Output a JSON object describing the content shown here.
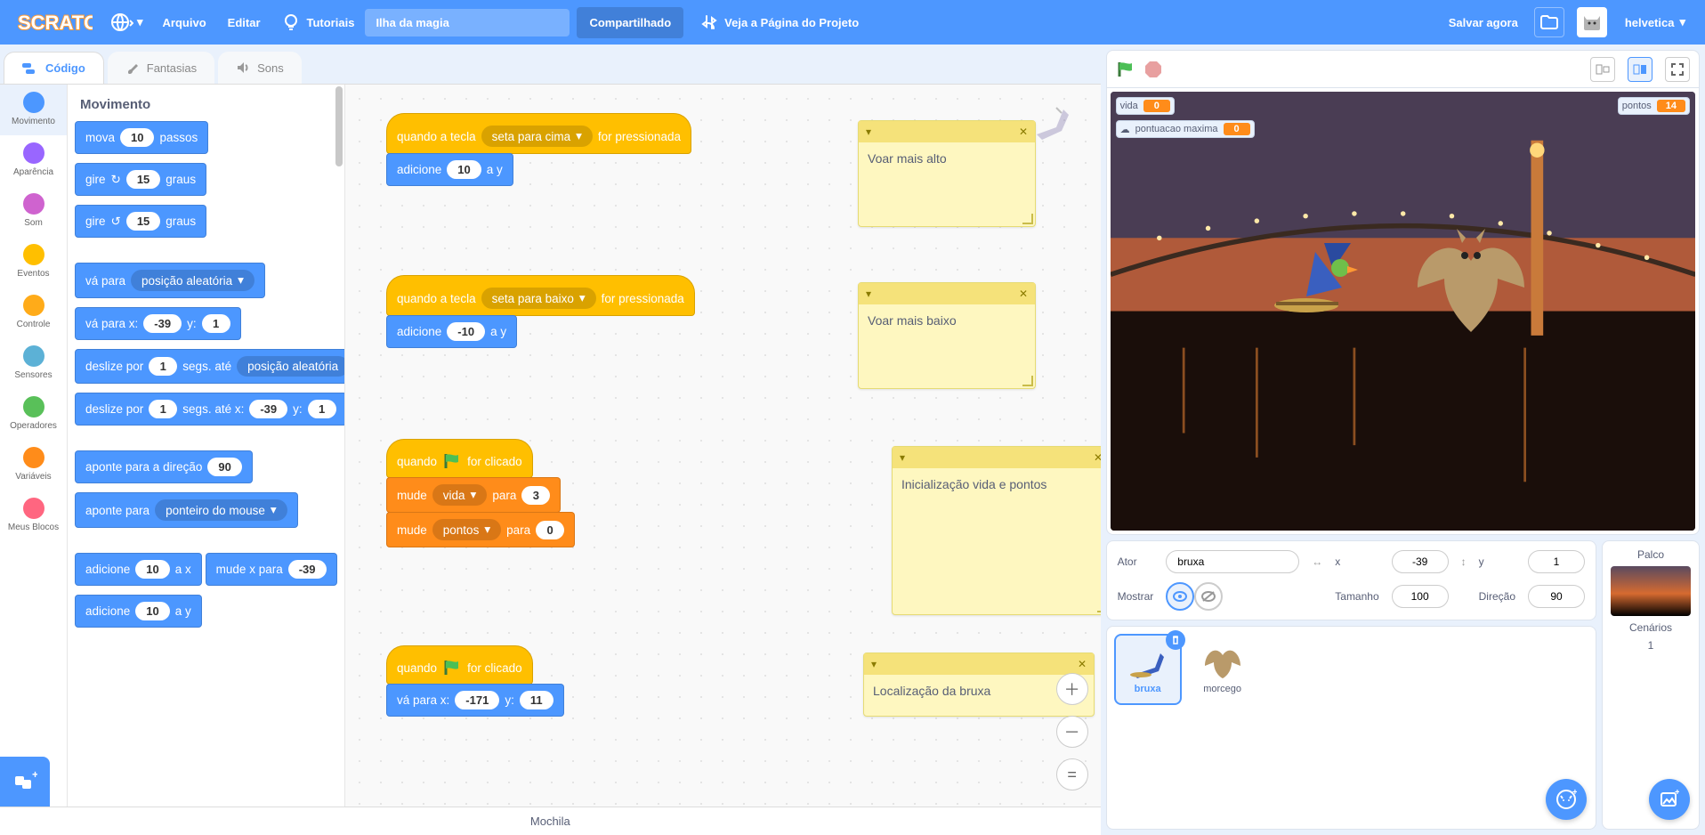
{
  "menubar": {
    "file": "Arquivo",
    "edit": "Editar",
    "tutorials": "Tutoriais",
    "project_title": "Ilha da magia",
    "share": "Compartilhado",
    "see_project_page": "Veja a Página do Projeto",
    "save_now": "Salvar agora",
    "username": "helvetica"
  },
  "tabs": {
    "code": "Código",
    "costumes": "Fantasias",
    "sounds": "Sons"
  },
  "categories": [
    {
      "name": "Movimento",
      "color": "#4c97ff",
      "selected": true
    },
    {
      "name": "Aparência",
      "color": "#9966ff"
    },
    {
      "name": "Som",
      "color": "#cf63cf"
    },
    {
      "name": "Eventos",
      "color": "#ffbf00"
    },
    {
      "name": "Controle",
      "color": "#ffab19"
    },
    {
      "name": "Sensores",
      "color": "#5cb1d6"
    },
    {
      "name": "Operadores",
      "color": "#59c059"
    },
    {
      "name": "Variáveis",
      "color": "#ff8c1a"
    },
    {
      "name": "Meus Blocos",
      "color": "#ff6680"
    }
  ],
  "palette_header": "Movimento",
  "palette_blocks": {
    "move_a": "mova",
    "move_steps": "10",
    "move_b": "passos",
    "turn_a": "gire",
    "turn_deg1": "15",
    "turn_deg2": "15",
    "turn_b": "graus",
    "goto_a": "vá para",
    "goto_opt": "posição aleatória",
    "gotoxy_a": "vá para x:",
    "gotoxy_x": "-39",
    "gotoxy_y_lbl": "y:",
    "gotoxy_y": "1",
    "glide_a": "deslize por",
    "glide_secs1": "1",
    "glide_b": "segs. até",
    "glide_opt": "posição aleatória",
    "glidexy_a": "deslize por",
    "glidexy_secs": "1",
    "glidexy_b": "segs. até x:",
    "glidexy_x": "-39",
    "glidexy_y_lbl": "y:",
    "glidexy_y": "1",
    "point_dir_a": "aponte  para a direção",
    "point_dir_v": "90",
    "point_to_a": "aponte para",
    "point_to_opt": "ponteiro do mouse",
    "changex_a": "adicione",
    "changex_v": "10",
    "changex_b": "a x",
    "setx_a": "mude x para",
    "setx_v": "-39",
    "changey_a": "adicione",
    "changey_v": "10",
    "changey_b": "a y"
  },
  "scripts": {
    "s1": {
      "hat_a": "quando a tecla",
      "hat_opt": "seta para cima",
      "hat_b": "for pressionada",
      "b1_a": "adicione",
      "b1_v": "10",
      "b1_b": "a y",
      "comment": "Voar mais alto"
    },
    "s2": {
      "hat_a": "quando a tecla",
      "hat_opt": "seta para baixo",
      "hat_b": "for pressionada",
      "b1_a": "adicione",
      "b1_v": "-10",
      "b1_b": "a y",
      "comment": "Voar mais baixo"
    },
    "s3": {
      "hat_a": "quando",
      "hat_b": "for clicado",
      "b1_a": "mude",
      "b1_var": "vida",
      "b1_b": "para",
      "b1_v": "3",
      "b2_a": "mude",
      "b2_var": "pontos",
      "b2_b": "para",
      "b2_v": "0",
      "comment": "Inicialização vida e pontos"
    },
    "s4": {
      "hat_a": "quando",
      "hat_b": "for clicado",
      "b1_a": "vá para x:",
      "b1_x": "-171",
      "b1_y_lbl": "y:",
      "b1_y": "11",
      "comment": "Localização da bruxa"
    }
  },
  "backpack": "Mochila",
  "stage": {
    "monitors": {
      "vida_label": "vida",
      "vida_value": "0",
      "pm_label": "pontuacao maxima",
      "pm_value": "0",
      "pontos_label": "pontos",
      "pontos_value": "14"
    }
  },
  "sprite_info": {
    "actor_lbl": "Ator",
    "actor_name": "bruxa",
    "x_lbl": "x",
    "x": "-39",
    "y_lbl": "y",
    "y": "1",
    "show_lbl": "Mostrar",
    "size_lbl": "Tamanho",
    "size": "100",
    "dir_lbl": "Direção",
    "dir": "90"
  },
  "sprites": [
    {
      "name": "bruxa",
      "selected": true
    },
    {
      "name": "morcego",
      "selected": false
    }
  ],
  "stage_panel": {
    "title": "Palco",
    "backdrops_lbl": "Cenários",
    "backdrops_count": "1"
  },
  "zoom": {
    "eq": "="
  }
}
